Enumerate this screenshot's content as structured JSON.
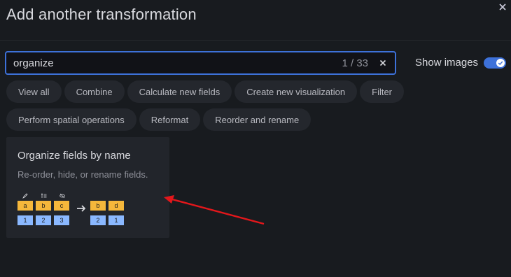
{
  "dialog": {
    "title": "Add another transformation"
  },
  "search": {
    "value": "organize",
    "result_count": "1 / 33"
  },
  "show_images": {
    "label": "Show images",
    "enabled": true
  },
  "filter_chips": [
    {
      "label": "View all"
    },
    {
      "label": "Combine"
    },
    {
      "label": "Calculate new fields"
    },
    {
      "label": "Create new visualization"
    },
    {
      "label": "Filter"
    },
    {
      "label": "Perform spatial operations"
    },
    {
      "label": "Reformat"
    },
    {
      "label": "Reorder and rename"
    }
  ],
  "result_card": {
    "title": "Organize fields by name",
    "description": "Re-order, hide, or rename fields.",
    "diagram": {
      "before_headers": [
        "a",
        "b",
        "c"
      ],
      "before_values": [
        "1",
        "2",
        "3"
      ],
      "header_icons": [
        "pencil-icon",
        "reorder-icon",
        "eye-off-icon"
      ],
      "after_headers": [
        "b",
        "d"
      ],
      "after_values": [
        "2",
        "1"
      ]
    }
  },
  "colors": {
    "accent": "#3d71d9",
    "header_cell": "#f5b73b",
    "value_cell": "#8ab8ff",
    "annotation_arrow": "#e3171b"
  }
}
